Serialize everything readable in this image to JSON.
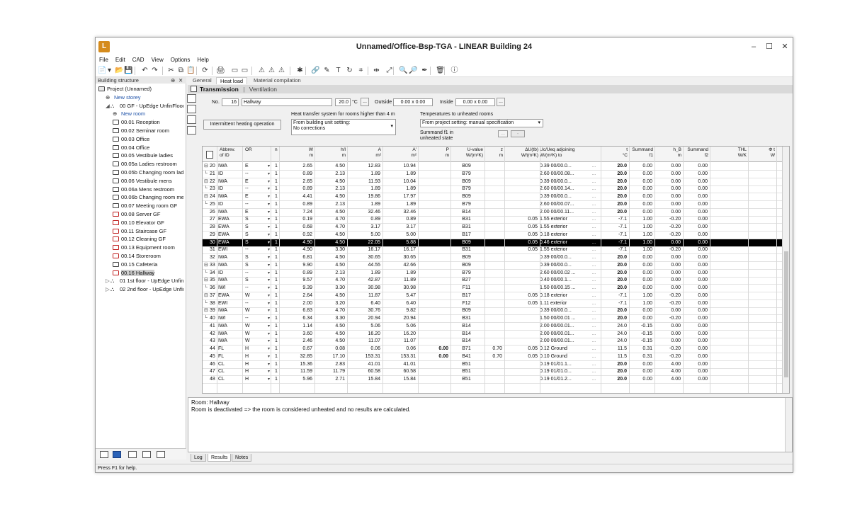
{
  "window": {
    "title": "Unnamed/Office-Bsp-TGA - LINEAR Building 24",
    "logo_text": "L",
    "minimize_icon": "–",
    "maximize_icon": "☐",
    "close_icon": "✕"
  },
  "menu": [
    "File",
    "Edit",
    "CAD",
    "View",
    "Options",
    "Help"
  ],
  "toolbar_icons": [
    "📄",
    "▾",
    "📂",
    "💾",
    "↶",
    "↷",
    "✂",
    "⧉",
    "📋",
    "⟳",
    "🖨",
    "▭",
    "▭",
    "⚠",
    "⚠",
    "⚠",
    "✱",
    "🔗",
    "✎",
    "T",
    "↻",
    "⌗",
    "⇹",
    "⤢",
    "🔍",
    "🔎",
    "✒",
    "🗑",
    "ⓘ"
  ],
  "sidebar": {
    "title": "Building structure",
    "pin_icon": "⊕",
    "close_icon": "✕",
    "tree": [
      {
        "label": "Project (Unnamed)",
        "indent": 0,
        "icon": "doc",
        "red": false
      },
      {
        "label": "New storey",
        "indent": 1,
        "icon": "plus",
        "red": false,
        "link": true
      },
      {
        "label": "00 GF - UpEdge UnfinFloor",
        "indent": 1,
        "icon": "storey",
        "red": false
      },
      {
        "label": "New room",
        "indent": 2,
        "icon": "plus",
        "red": false,
        "link": true
      },
      {
        "label": "00.01 Reception",
        "indent": 2,
        "icon": "room",
        "red": false
      },
      {
        "label": "00.02 Seminar room",
        "indent": 2,
        "icon": "room",
        "red": false
      },
      {
        "label": "00.03 Office",
        "indent": 2,
        "icon": "room",
        "red": false
      },
      {
        "label": "00.04 Office",
        "indent": 2,
        "icon": "room",
        "red": false
      },
      {
        "label": "00.05 Vestibule ladies",
        "indent": 2,
        "icon": "room",
        "red": false
      },
      {
        "label": "00.05a Ladies restroom",
        "indent": 2,
        "icon": "room",
        "red": false
      },
      {
        "label": "00.05b Changing room lad",
        "indent": 2,
        "icon": "room",
        "red": false
      },
      {
        "label": "00.06 Vestibule mens",
        "indent": 2,
        "icon": "room",
        "red": false
      },
      {
        "label": "00.06a Mens restroom",
        "indent": 2,
        "icon": "room",
        "red": false
      },
      {
        "label": "00.06b Changing room me",
        "indent": 2,
        "icon": "room",
        "red": false
      },
      {
        "label": "00.07 Meeting room GF",
        "indent": 2,
        "icon": "room",
        "red": false
      },
      {
        "label": "00.08 Server GF",
        "indent": 2,
        "icon": "room",
        "red": true
      },
      {
        "label": "00.10 Elevator GF",
        "indent": 2,
        "icon": "room",
        "red": true
      },
      {
        "label": "00.11 Staircase GF",
        "indent": 2,
        "icon": "room",
        "red": true
      },
      {
        "label": "00.12 Cleaning GF",
        "indent": 2,
        "icon": "room",
        "red": true
      },
      {
        "label": "00.13 Equipment room",
        "indent": 2,
        "icon": "room",
        "red": true
      },
      {
        "label": "00.14 Storeroom",
        "indent": 2,
        "icon": "room",
        "red": true
      },
      {
        "label": "00.15 Cafeteria",
        "indent": 2,
        "icon": "room",
        "red": false
      },
      {
        "label": "00.16 Hallway",
        "indent": 2,
        "icon": "room",
        "red": true,
        "selected": true
      },
      {
        "label": "01 1st floor - UpEdge UnfinFl",
        "indent": 1,
        "icon": "storey",
        "red": false,
        "collapsed": true
      },
      {
        "label": "02 2nd floor - UpEdge UnfinF",
        "indent": 1,
        "icon": "storey",
        "red": false,
        "collapsed": true
      }
    ]
  },
  "tabs": [
    "General",
    "Heat load",
    "Material compilation"
  ],
  "subhead": {
    "active": "Transmission",
    "sep": "|",
    "other": "Ventilation"
  },
  "form": {
    "no_label": "No.",
    "no_value": "16",
    "name_value": "Hallway",
    "temp_value": "20.0",
    "temp_unit": "°C",
    "more": "...",
    "outside_label": "Outside",
    "outside_value": "0.00 x 0.00",
    "inside_label": "Inside",
    "inside_value": "0.00 x 0.00",
    "intermittent_button": "Intermittent heating operation",
    "heat_transfer_label": "Heat transfer system for rooms higher than 4 m",
    "heat_transfer_line1": "From building unit setting:",
    "heat_transfer_line2": "No corrections",
    "temps_label": "Temperatures to unheated rooms",
    "temps_value": "From project setting: manual specification",
    "summand_label1": "Summand f1 in",
    "summand_label2": "unheated state",
    "summand_more": "...",
    "summand_dash": "-"
  },
  "grid": {
    "headers": [
      [
        "Abbrev.",
        "of ID"
      ],
      [
        "OR",
        ""
      ],
      [
        "n",
        ""
      ],
      [
        "W",
        "m"
      ],
      [
        "h/l",
        "m"
      ],
      [
        "A",
        "m²"
      ],
      [
        "A'",
        "m²"
      ],
      [
        "P",
        "m"
      ],
      [
        "U-value",
        "W/(m²K)"
      ],
      [
        "z",
        "m"
      ],
      [
        "ΔU(tb)",
        "W/(m²K)"
      ],
      [
        "Uc/Ueq adjoining",
        "W/(m²K) to"
      ],
      [
        "t",
        "°C"
      ],
      [
        "Summand",
        "f1"
      ],
      [
        "h_B",
        "m"
      ],
      [
        "Summand",
        "f2"
      ],
      [
        "THL",
        "W/K"
      ],
      [
        "Φ t",
        "W"
      ]
    ],
    "rows": [
      [
        "20",
        "IWA",
        "E",
        "1",
        "2.65",
        "4.50",
        "12.83",
        "10.94",
        "",
        "B09",
        "",
        "",
        "0.39 00/00.0...",
        "20.0",
        "0.00",
        "0.00",
        "0.00",
        "",
        "",
        "1"
      ],
      [
        "21",
        "ID",
        "--",
        "1",
        "0.89",
        "2.13",
        "1.89",
        "1.89",
        "",
        "B79",
        "",
        "",
        "2.60 00/00.08...",
        "20.0",
        "0.00",
        "0.00",
        "0.00",
        "",
        "",
        "0"
      ],
      [
        "22",
        "IWA",
        "E",
        "1",
        "2.65",
        "4.50",
        "11.93",
        "10.04",
        "",
        "B09",
        "",
        "",
        "0.39 00/00.0...",
        "20.0",
        "0.00",
        "0.00",
        "0.00",
        "",
        "",
        "1"
      ],
      [
        "23",
        "ID",
        "--",
        "1",
        "0.89",
        "2.13",
        "1.89",
        "1.89",
        "",
        "B79",
        "",
        "",
        "2.60 00/00.14...",
        "20.0",
        "0.00",
        "0.00",
        "0.00",
        "",
        "",
        "0"
      ],
      [
        "24",
        "IWA",
        "E",
        "1",
        "4.41",
        "4.50",
        "19.86",
        "17.97",
        "",
        "B09",
        "",
        "",
        "0.39 00/00.0...",
        "20.0",
        "0.00",
        "0.00",
        "0.00",
        "",
        "",
        "1"
      ],
      [
        "25",
        "ID",
        "--",
        "1",
        "0.89",
        "2.13",
        "1.89",
        "1.89",
        "",
        "B79",
        "",
        "",
        "2.60 00/00.07...",
        "20.0",
        "0.00",
        "0.00",
        "0.00",
        "",
        "",
        "0"
      ],
      [
        "26",
        "IWA",
        "E",
        "1",
        "7.24",
        "4.50",
        "32.46",
        "32.46",
        "",
        "B14",
        "",
        "",
        "2.00 00/00.11...",
        "20.0",
        "0.00",
        "0.00",
        "0.00",
        "",
        "",
        "0"
      ],
      [
        "27",
        "EWA",
        "S",
        "1",
        "0.19",
        "4.70",
        "0.89",
        "0.89",
        "",
        "B31",
        "",
        "0.05",
        "1.55 exterior",
        "-7.1",
        "1.00",
        "-0.20",
        "0.00",
        "",
        "",
        "0"
      ],
      [
        "28",
        "EWA",
        "S",
        "1",
        "0.68",
        "4.70",
        "3.17",
        "3.17",
        "",
        "B31",
        "",
        "0.05",
        "1.55 exterior",
        "-7.1",
        "1.00",
        "-0.20",
        "0.00",
        "",
        "",
        "0"
      ],
      [
        "29",
        "EWA",
        "S",
        "1",
        "0.92",
        "4.50",
        "5.00",
        "5.00",
        "",
        "B17",
        "",
        "0.05",
        "0.18 exterior",
        "-7.1",
        "1.00",
        "-0.20",
        "0.00",
        "",
        "",
        "0"
      ],
      [
        "30",
        "EWA",
        "S",
        "1",
        "4.90",
        "4.50",
        "22.05",
        "5.88",
        "",
        "B09",
        "",
        "0.05",
        "0.46 exterior",
        "-7.1",
        "1.00",
        "0.00",
        "0.00",
        "",
        "",
        "0"
      ],
      [
        "31",
        "EWI",
        "--",
        "1",
        "4.90",
        "3.30",
        "16.17",
        "16.17",
        "",
        "B31",
        "",
        "0.05",
        "1.55 exterior",
        "-7.1",
        "1.00",
        "-0.20",
        "0.00",
        "",
        "",
        "0"
      ],
      [
        "32",
        "IWA",
        "S",
        "1",
        "6.81",
        "4.50",
        "30.65",
        "30.65",
        "",
        "B09",
        "",
        "",
        "0.39 00/00.0...",
        "20.0",
        "0.00",
        "0.00",
        "0.00",
        "",
        "",
        "0"
      ],
      [
        "33",
        "IWA",
        "S",
        "1",
        "9.90",
        "4.50",
        "44.55",
        "42.66",
        "",
        "B09",
        "",
        "",
        "0.39 00/00.0...",
        "20.0",
        "0.00",
        "0.00",
        "0.00",
        "",
        "",
        "1"
      ],
      [
        "34",
        "ID",
        "--",
        "1",
        "0.89",
        "2.13",
        "1.89",
        "1.89",
        "",
        "B79",
        "",
        "",
        "2.60 00/00.02 ...",
        "20.0",
        "0.00",
        "0.00",
        "0.00",
        "",
        "",
        "0"
      ],
      [
        "35",
        "IWA",
        "S",
        "1",
        "9.57",
        "4.70",
        "42.87",
        "11.89",
        "",
        "B27",
        "",
        "",
        "0.40 00/00.1...",
        "20.0",
        "0.00",
        "0.00",
        "0.00",
        "",
        "",
        "1"
      ],
      [
        "36",
        "IWI",
        "--",
        "1",
        "9.39",
        "3.30",
        "30.98",
        "30.98",
        "",
        "F11",
        "",
        "",
        "1.50 00/00.15 ...",
        "20.0",
        "0.00",
        "0.00",
        "0.00",
        "",
        "",
        "0"
      ],
      [
        "37",
        "EWA",
        "W",
        "1",
        "2.64",
        "4.50",
        "11.87",
        "5.47",
        "",
        "B17",
        "",
        "0.05",
        "0.18 exterior",
        "-7.1",
        "1.00",
        "-0.20",
        "0.00",
        "",
        "",
        "1"
      ],
      [
        "38",
        "EWI",
        "--",
        "1",
        "2.00",
        "3.20",
        "6.40",
        "6.40",
        "",
        "F12",
        "",
        "0.05",
        "1.11 exterior",
        "-7.1",
        "1.00",
        "-0.20",
        "0.00",
        "",
        "",
        "0"
      ],
      [
        "39",
        "IWA",
        "W",
        "1",
        "6.83",
        "4.70",
        "30.76",
        "9.82",
        "",
        "B09",
        "",
        "",
        "0.39 00/00.0...",
        "20.0",
        "0.00",
        "0.00",
        "0.00",
        "",
        "",
        "1"
      ],
      [
        "40",
        "IWI",
        "--",
        "1",
        "6.34",
        "3.30",
        "20.94",
        "20.94",
        "",
        "B31",
        "",
        "",
        "1.50 00/00.01 ...",
        "20.0",
        "0.00",
        "-0.20",
        "0.00",
        "",
        "",
        "0"
      ],
      [
        "41",
        "IWA",
        "W",
        "1",
        "1.14",
        "4.50",
        "5.06",
        "5.06",
        "",
        "B14",
        "",
        "",
        "2.00 00/00.01...",
        "24.0",
        "-0.15",
        "0.00",
        "0.00",
        "",
        "",
        "0"
      ],
      [
        "42",
        "IWA",
        "W",
        "1",
        "3.60",
        "4.50",
        "16.20",
        "16.20",
        "",
        "B14",
        "",
        "",
        "2.00 00/00.01...",
        "24.0",
        "-0.15",
        "0.00",
        "0.00",
        "",
        "",
        "0"
      ],
      [
        "43",
        "IWA",
        "W",
        "1",
        "2.46",
        "4.50",
        "11.07",
        "11.07",
        "",
        "B14",
        "",
        "",
        "2.00 00/00.01...",
        "24.0",
        "-0.15",
        "0.00",
        "0.00",
        "",
        "",
        "0"
      ],
      [
        "44",
        "FL",
        "H",
        "1",
        "0.67",
        "0.08",
        "0.06",
        "0.06",
        "0.00",
        "B71",
        "0.70",
        "0.05",
        "0.12 Ground",
        "11.5",
        "0.31",
        "-0.20",
        "0.00",
        "",
        "",
        "0"
      ],
      [
        "45",
        "FL",
        "H",
        "1",
        "32.85",
        "17.10",
        "153.31",
        "153.31",
        "0.00",
        "B41",
        "0.70",
        "0.05",
        "0.10 Ground",
        "11.5",
        "0.31",
        "-0.20",
        "0.00",
        "",
        "",
        "0"
      ],
      [
        "46",
        "CL",
        "H",
        "1",
        "15.36",
        "2.83",
        "41.01",
        "41.01",
        "",
        "B51",
        "",
        "",
        "0.19 01/01.1...",
        "20.0",
        "0.00",
        "4.00",
        "0.00",
        "",
        "",
        "0"
      ],
      [
        "47",
        "CL",
        "H",
        "1",
        "11.59",
        "11.79",
        "60.58",
        "60.58",
        "",
        "B51",
        "",
        "",
        "0.19 01/01.0...",
        "20.0",
        "0.00",
        "4.00",
        "0.00",
        "",
        "",
        "0"
      ],
      [
        "48",
        "CL",
        "H",
        "1",
        "5.96",
        "2.71",
        "15.84",
        "15.84",
        "",
        "B51",
        "",
        "",
        "0.19 01/01.2...",
        "20.0",
        "0.00",
        "4.00",
        "0.00",
        "",
        "",
        "0"
      ]
    ],
    "selected_row": 10
  },
  "message": {
    "line1": "Room: Hallway",
    "line2": "Room is deactivated => the room is considered unheated and no results are calculated."
  },
  "bottom_tabs": [
    "Log",
    "Results",
    "Notes"
  ],
  "status": "Press F1 for help."
}
